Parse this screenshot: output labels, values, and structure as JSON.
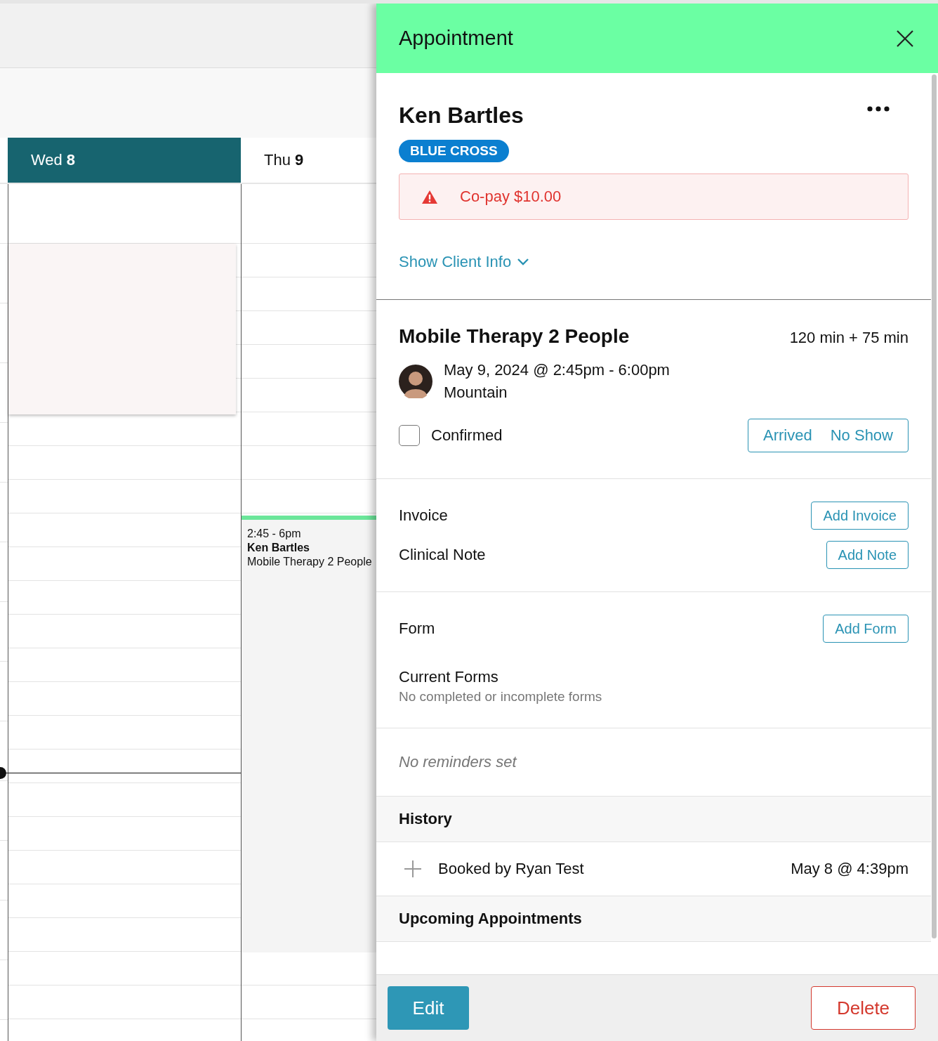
{
  "calendar": {
    "days": [
      {
        "weekday": "Wed",
        "day": "8",
        "selected": true
      },
      {
        "weekday": "Thu",
        "day": "9",
        "selected": false
      }
    ],
    "events": [
      {
        "time": "2:45 - 6pm",
        "client": "Ken Bartles",
        "service": "Mobile Therapy 2 People"
      }
    ]
  },
  "panel": {
    "title": "Appointment",
    "client": {
      "name": "Ken Bartles",
      "insurance": "BLUE CROSS",
      "alert": "Co-pay $10.00",
      "toggle": "Show Client Info"
    },
    "service": {
      "name": "Mobile Therapy 2 People",
      "duration": "120 min + 75 min",
      "datetime": "May 9, 2024 @ 2:45pm - 6:00pm",
      "timezone": "Mountain",
      "confirmed": {
        "label": "Confirmed",
        "checked": false
      },
      "status_buttons": [
        "Arrived",
        "No Show"
      ]
    },
    "documents": [
      {
        "label": "Invoice",
        "button": "Add Invoice"
      },
      {
        "label": "Clinical Note",
        "button": "Add Note"
      }
    ],
    "form": {
      "label": "Form",
      "button": "Add Form",
      "current_title": "Current Forms",
      "current_empty": "No completed or incomplete forms"
    },
    "reminders": "No reminders set",
    "history": {
      "title": "History",
      "entries": [
        {
          "text": "Booked by Ryan Test",
          "time": "May 8 @ 4:39pm"
        }
      ]
    },
    "upcoming": {
      "title": "Upcoming Appointments"
    },
    "footer": {
      "edit": "Edit",
      "delete": "Delete"
    }
  }
}
